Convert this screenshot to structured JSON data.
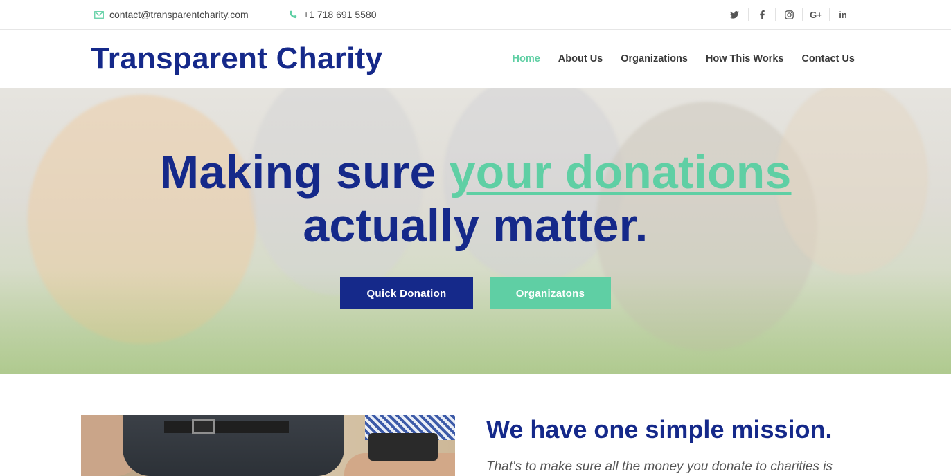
{
  "topbar": {
    "email": "contact@transparentcharity.com",
    "phone": "+1 718 691 5580",
    "social": [
      {
        "name": "twitter-icon"
      },
      {
        "name": "facebook-icon"
      },
      {
        "name": "instagram-icon"
      },
      {
        "name": "google-plus-icon",
        "glyph": "G+"
      },
      {
        "name": "linkedin-icon",
        "glyph": "in"
      }
    ]
  },
  "header": {
    "logo": "Transparent Charity",
    "nav": [
      {
        "label": "Home",
        "active": true
      },
      {
        "label": "About Us"
      },
      {
        "label": "Organizations"
      },
      {
        "label": "How This Works"
      },
      {
        "label": "Contact Us"
      }
    ]
  },
  "hero": {
    "title_part1": "Making sure ",
    "title_highlight": "your donations",
    "title_part2": "actually matter.",
    "buttons": {
      "quick_donation": "Quick Donation",
      "organizations": "Organizatons"
    }
  },
  "mission": {
    "title": "We have one simple mission.",
    "text": "That's to make sure all the money you donate to charities is"
  },
  "colors": {
    "brand_blue": "#15298a",
    "accent_green": "#5fcfa4"
  }
}
